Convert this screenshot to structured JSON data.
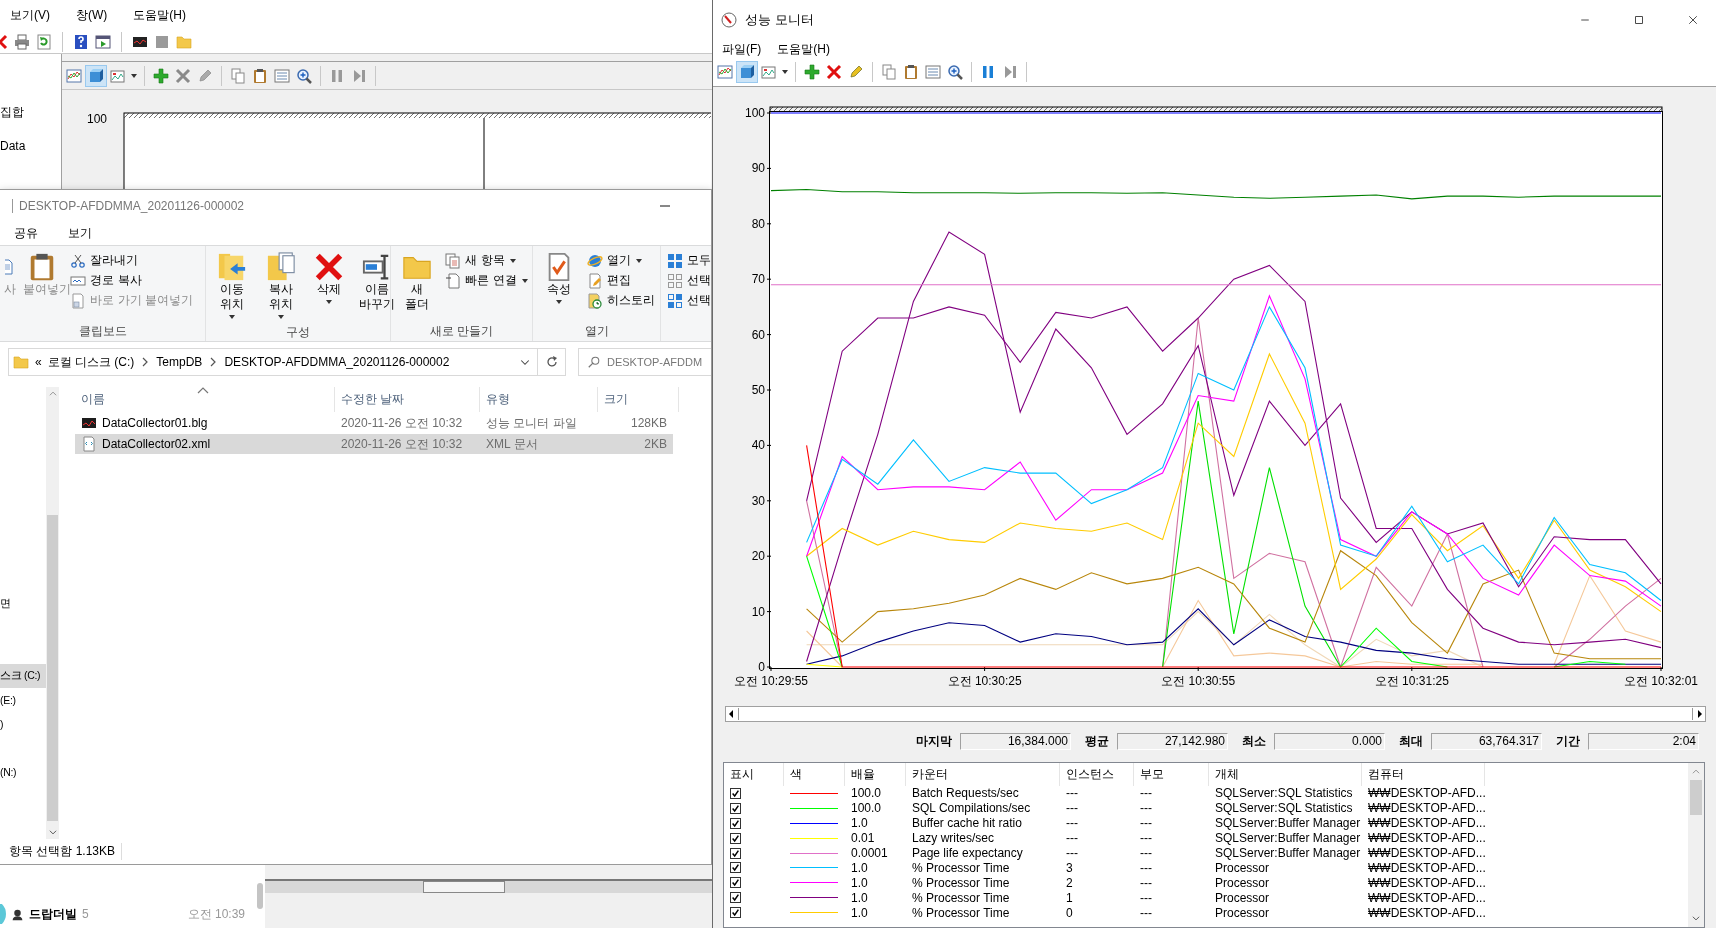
{
  "background_window": {
    "menu": [
      "보기(V)",
      "창(W)",
      "도움말(H)"
    ],
    "tree_items": [
      "집합",
      "Data"
    ],
    "toolbar": [
      {
        "selected": false
      },
      {
        "selected": true
      },
      {
        "selected": false
      },
      {
        "selected": false
      },
      {
        "selected": false
      },
      {
        "selected": false
      },
      {
        "selected": false
      },
      {
        "selected": false
      },
      {
        "selected": false
      },
      {
        "selected": false
      },
      {
        "selected": false
      },
      {
        "selected": false
      }
    ],
    "chart_label": "100"
  },
  "explorer": {
    "title": "DESKTOP-AFDDMMA_20201126-000002",
    "tabs": [
      "공유",
      "보기"
    ],
    "ribbon": [
      {
        "label": "클립보드",
        "large": [
          {
            "label": "사",
            "dropdown": false,
            "disabled": true
          },
          {
            "label": "붙여넣기",
            "dropdown": false,
            "disabled": true
          }
        ],
        "small": [
          {
            "label": "잘라내기",
            "dropdown": false,
            "disabled": false
          },
          {
            "label": "경로 복사",
            "dropdown": false,
            "disabled": false
          },
          {
            "label": "바로 가기 붙여넣기",
            "dropdown": false,
            "disabled": true
          }
        ]
      },
      {
        "label": "구성",
        "large": [
          {
            "label": "이동 위치",
            "dropdown": true,
            "disabled": false
          },
          {
            "label": "복사 위치",
            "dropdown": true,
            "disabled": false
          },
          {
            "label": "삭제",
            "dropdown": true,
            "disabled": false
          },
          {
            "label": "이름 바꾸기",
            "dropdown": false,
            "disabled": false
          }
        ]
      },
      {
        "label": "새로 만들기",
        "large": [
          {
            "label": "새 폴더",
            "dropdown": false,
            "disabled": false
          }
        ],
        "small": [
          {
            "label": "새 항목",
            "dropdown": true,
            "disabled": false
          },
          {
            "label": "빠른 연결",
            "dropdown": true,
            "disabled": false
          }
        ]
      },
      {
        "label": "열기",
        "large": [
          {
            "label": "속성",
            "dropdown": true,
            "disabled": false
          }
        ],
        "small": [
          {
            "label": "열기",
            "dropdown": true,
            "disabled": false
          },
          {
            "label": "편집",
            "dropdown": false,
            "disabled": false
          },
          {
            "label": "히스토리",
            "dropdown": false,
            "disabled": false
          }
        ]
      },
      {
        "small": [
          {
            "label": "모두",
            "dropdown": false,
            "disabled": false
          },
          {
            "label": "선택",
            "dropdown": false,
            "disabled": false
          },
          {
            "label": "선택",
            "dropdown": false,
            "disabled": false
          }
        ]
      }
    ],
    "address": {
      "overflow": "«",
      "crumbs": [
        "로컬 디스크 (C:)",
        "TempDB",
        "DESKTOP-AFDDMMA_20201126-000002"
      ]
    },
    "search": {
      "placeholder": "DESKTOP-AFDDM"
    },
    "nav_items": [
      {
        "label": "면",
        "selected": false
      },
      {
        "label": "스크 (C:)",
        "selected": true
      },
      {
        "label": "(E:)",
        "selected": false
      },
      {
        "label": ")",
        "selected": false
      },
      {
        "label": "(N:)",
        "selected": false
      }
    ],
    "columns": [
      "이름",
      "수정한 날짜",
      "유형",
      "크기"
    ],
    "files": [
      {
        "kind": "blg",
        "name": "DataCollector01.blg",
        "date": "2020-11-26 오전 10:32",
        "type": "성능 모니터 파일",
        "size": "128KB",
        "selected": false
      },
      {
        "kind": "xml",
        "name": "DataCollector02.xml",
        "date": "2020-11-26 오전 10:32",
        "type": "XML 문서",
        "size": "2KB",
        "selected": true
      }
    ],
    "status": "항목 선택함 1.13KB"
  },
  "chat": {
    "name": "드랍더빌",
    "count": "5",
    "time": "오전 10:39"
  },
  "perfmon": {
    "title": "성능 모니터",
    "menu": [
      "파일(F)",
      "도움말(H)"
    ],
    "toolbar": [
      {
        "selected": false
      },
      {
        "selected": true
      },
      {
        "selected": false
      },
      {
        "selected": false
      },
      {
        "selected": false
      },
      {
        "selected": false
      },
      {
        "selected": false
      },
      {
        "selected": false
      },
      {
        "selected": false
      },
      {
        "selected": false
      },
      {
        "selected": false
      },
      {
        "selected": false
      }
    ],
    "chart_data": {
      "type": "line",
      "categories": [
        "오전 10:29:55",
        null,
        null,
        null,
        null,
        null,
        "오전 10:30:25",
        null,
        null,
        null,
        null,
        null,
        "오전 10:30:55",
        null,
        null,
        null,
        null,
        null,
        "오전 10:31:25",
        null,
        null,
        null,
        null,
        null,
        null,
        "오전 10:32:01"
      ],
      "ylim": [
        0,
        100
      ],
      "yticks": [
        0,
        10,
        20,
        30,
        40,
        50,
        60,
        70,
        80,
        90,
        100
      ],
      "series": [
        {
          "color": "#ff0000",
          "values": [
            null,
            40,
            0,
            0,
            0,
            0,
            0,
            0,
            0,
            0,
            0,
            0,
            0,
            0,
            0,
            0,
            0,
            0,
            0,
            0,
            0,
            0,
            0,
            0,
            0,
            0
          ]
        },
        {
          "color": "#00ff00",
          "values": [
            null,
            20,
            0,
            null,
            null,
            null,
            null,
            null,
            null,
            null,
            null,
            null,
            null,
            null,
            null,
            null,
            0,
            7,
            1,
            0,
            null,
            null,
            0,
            1,
            0.5,
            null
          ]
        },
        {
          "color": "#0000ff",
          "values": [
            100,
            100,
            100,
            100,
            100,
            100,
            100,
            100,
            100,
            100,
            100,
            100,
            100,
            100,
            100,
            100,
            100,
            100,
            100,
            100,
            100,
            100,
            100,
            100,
            100,
            100
          ]
        },
        {
          "color": "#ffff00",
          "values": [
            null,
            0.5,
            0,
            null,
            null,
            null,
            null,
            null,
            null,
            null,
            null,
            null,
            null,
            null,
            null,
            null,
            null,
            null,
            null,
            null,
            null,
            null,
            null,
            null,
            null,
            null
          ]
        },
        {
          "color": "#e070c8",
          "values": [
            69,
            69,
            69,
            69,
            69,
            69,
            69,
            69,
            69,
            69,
            69,
            69,
            69,
            69,
            69,
            69,
            69,
            69,
            69,
            69,
            69,
            69,
            69,
            69,
            69,
            69
          ]
        },
        {
          "color": "#00bfff",
          "values": [
            null,
            22.5,
            37.5,
            33,
            41,
            33.5,
            36,
            35,
            35,
            29.5,
            32,
            36,
            53,
            50,
            65,
            54,
            22,
            20,
            29,
            19,
            22,
            15,
            27,
            18.5,
            17,
            12
          ]
        },
        {
          "color": "#ff00ff",
          "values": [
            null,
            20,
            38,
            32,
            32.5,
            32.5,
            32,
            37,
            26.5,
            32,
            32,
            35,
            49,
            48,
            67,
            52,
            23,
            20,
            28,
            24,
            16,
            13,
            22,
            16.5,
            15.5,
            11
          ]
        },
        {
          "color": "#800080",
          "values": [
            null,
            30,
            57,
            63,
            63,
            65,
            63.5,
            55,
            64,
            63,
            65,
            57,
            63,
            70,
            72.5,
            66,
            30.5,
            22.5,
            28,
            24,
            26,
            14.5,
            23.5,
            23,
            23,
            15
          ]
        },
        {
          "color": "#ffcc00",
          "values": [
            null,
            20,
            25,
            22,
            24.5,
            23,
            22.5,
            26,
            25,
            24.5,
            26,
            23,
            44,
            38,
            56.5,
            44,
            14,
            19.5,
            27.5,
            21,
            25.5,
            16,
            26.5,
            17.5,
            14.5,
            10
          ]
        },
        {
          "color": "#008000",
          "values": [
            86,
            86.2,
            85.8,
            85.8,
            85.6,
            85.6,
            85.6,
            85.5,
            85.6,
            85.6,
            85.5,
            85.6,
            85.2,
            84.8,
            84.6,
            84.8,
            85,
            85.2,
            84.5,
            85,
            85,
            84.8,
            85,
            85,
            85,
            85
          ]
        },
        {
          "color": "#800080",
          "values": [
            null,
            1,
            22,
            42,
            66,
            78.5,
            74.5,
            46,
            61,
            54,
            42,
            47.5,
            58,
            31,
            48,
            40,
            47.5,
            25,
            25,
            14,
            7,
            4.5,
            4,
            4.5,
            5,
            3.5
          ]
        },
        {
          "color": "#b8860b",
          "values": [
            null,
            10.5,
            4.5,
            10,
            10.5,
            11.5,
            13,
            16,
            14,
            17,
            15,
            16,
            18,
            15,
            7,
            4.5,
            21,
            16.5,
            8,
            2.5,
            15,
            17.5,
            2.5,
            1.5,
            1.5,
            1.5
          ]
        },
        {
          "color": "#000080",
          "values": [
            null,
            0.5,
            2,
            4.5,
            6.5,
            8,
            7.5,
            4.5,
            6,
            5.5,
            4,
            4.5,
            10.5,
            4,
            8.5,
            5.5,
            4.5,
            3,
            2.5,
            1.5,
            1,
            0.5,
            0.5,
            0.5,
            0.5,
            0.5
          ]
        },
        {
          "color": "#00e000",
          "values": [
            null,
            null,
            null,
            null,
            null,
            null,
            null,
            null,
            null,
            null,
            null,
            0,
            48,
            6,
            36,
            11,
            0,
            null,
            null,
            null,
            null,
            null,
            null,
            null,
            null,
            null
          ]
        },
        {
          "color": "#d070a0",
          "values": [
            null,
            30,
            0,
            null,
            null,
            null,
            null,
            null,
            null,
            null,
            null,
            0,
            63,
            16,
            20.5,
            19,
            0,
            18,
            11,
            24,
            0,
            null,
            0,
            5,
            11,
            16
          ]
        },
        {
          "color": "#f5c89a",
          "values": [
            null,
            6.5,
            0,
            null,
            null,
            null,
            null,
            null,
            null,
            null,
            null,
            0,
            12,
            2,
            2.5,
            2,
            0,
            1,
            0.5,
            0.5,
            0.5,
            null,
            0.5,
            16.5,
            6.5,
            4.5
          ]
        },
        {
          "color": "#f0d8b8",
          "values": [
            null,
            4,
            4,
            4,
            4,
            4,
            4,
            4,
            4,
            4,
            4,
            4,
            10,
            4,
            9.5,
            4,
            0,
            5,
            2,
            3,
            0,
            null,
            null,
            null,
            null,
            null
          ]
        }
      ]
    },
    "stats": [
      {
        "label": "마지막",
        "value": "16,384.000"
      },
      {
        "label": "평균",
        "value": "27,142.980"
      },
      {
        "label": "최소",
        "value": "0.000"
      },
      {
        "label": "최대",
        "value": "63,764.317"
      },
      {
        "label": "기간",
        "value": "2:04"
      }
    ],
    "columns": [
      "표시",
      "색",
      "배율",
      "카운터",
      "인스턴스",
      "부모",
      "개체",
      "컴퓨터"
    ],
    "counters": [
      {
        "checked": true,
        "color": "#ff0000",
        "scale": "100.0",
        "counter": "Batch Requests/sec",
        "instance": "---",
        "parent": "---",
        "object": "SQLServer:SQL Statistics",
        "computer": "₩₩DESKTOP-AFD..."
      },
      {
        "checked": true,
        "color": "#00ff00",
        "scale": "100.0",
        "counter": "SQL Compilations/sec",
        "instance": "---",
        "parent": "---",
        "object": "SQLServer:SQL Statistics",
        "computer": "₩₩DESKTOP-AFD..."
      },
      {
        "checked": true,
        "color": "#0000ff",
        "scale": "1.0",
        "counter": "Buffer cache hit ratio",
        "instance": "---",
        "parent": "---",
        "object": "SQLServer:Buffer Manager",
        "computer": "₩₩DESKTOP-AFD..."
      },
      {
        "checked": true,
        "color": "#ffff00",
        "scale": "0.01",
        "counter": "Lazy writes/sec",
        "instance": "---",
        "parent": "---",
        "object": "SQLServer:Buffer Manager",
        "computer": "₩₩DESKTOP-AFD..."
      },
      {
        "checked": true,
        "color": "#e070c8",
        "scale": "0.0001",
        "counter": "Page life expectancy",
        "instance": "---",
        "parent": "---",
        "object": "SQLServer:Buffer Manager",
        "computer": "₩₩DESKTOP-AFD..."
      },
      {
        "checked": true,
        "color": "#00bfff",
        "scale": "1.0",
        "counter": "% Processor Time",
        "instance": "3",
        "parent": "---",
        "object": "Processor",
        "computer": "₩₩DESKTOP-AFD..."
      },
      {
        "checked": true,
        "color": "#ff00ff",
        "scale": "1.0",
        "counter": "% Processor Time",
        "instance": "2",
        "parent": "---",
        "object": "Processor",
        "computer": "₩₩DESKTOP-AFD..."
      },
      {
        "checked": true,
        "color": "#800080",
        "scale": "1.0",
        "counter": "% Processor Time",
        "instance": "1",
        "parent": "---",
        "object": "Processor",
        "computer": "₩₩DESKTOP-AFD..."
      },
      {
        "checked": true,
        "color": "#ffcc00",
        "scale": "1.0",
        "counter": "% Processor Time",
        "instance": "0",
        "parent": "---",
        "object": "Processor",
        "computer": "₩₩DESKTOP-AFD..."
      }
    ]
  }
}
